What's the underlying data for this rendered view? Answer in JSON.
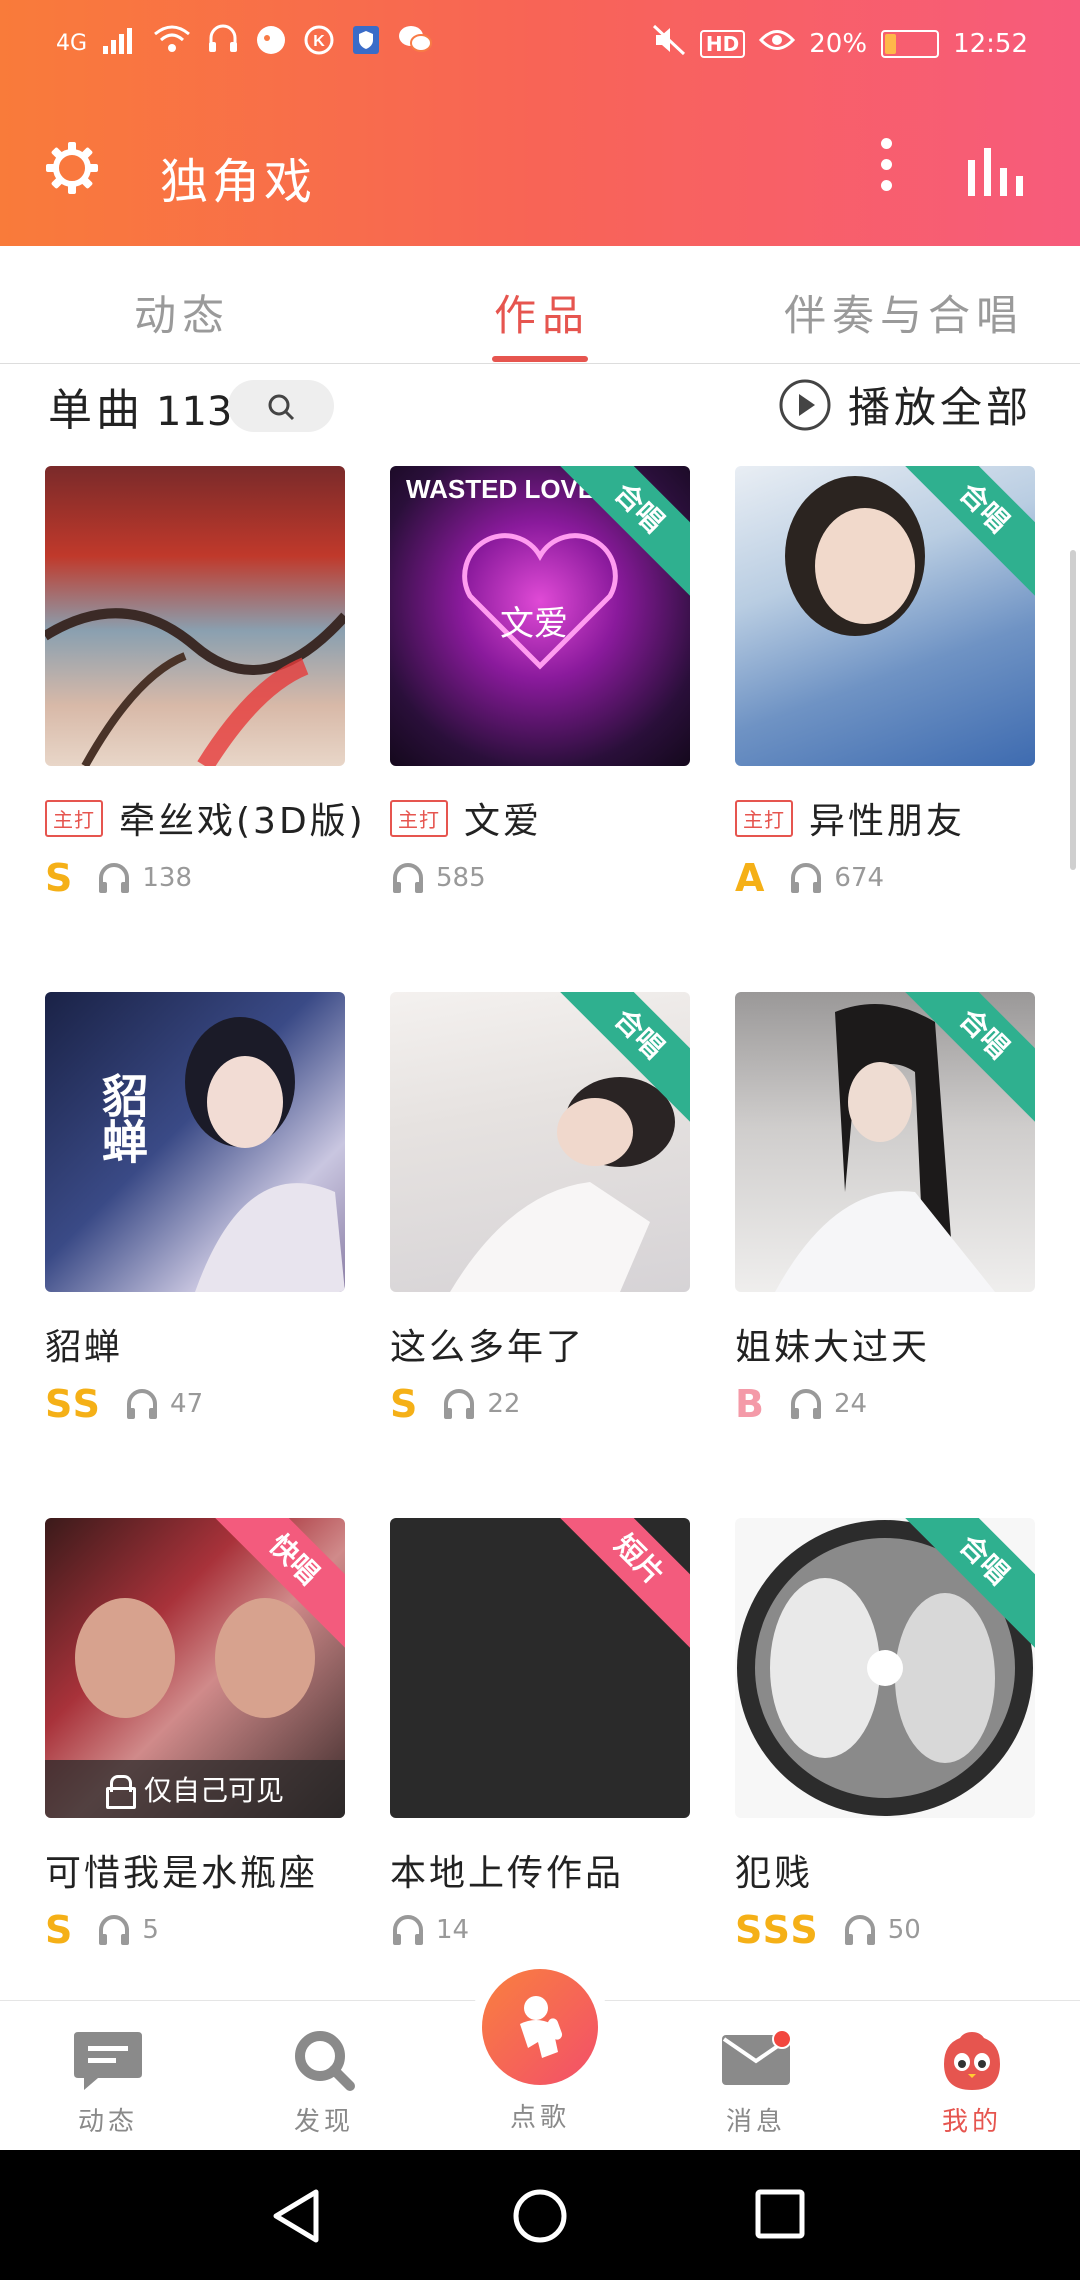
{
  "status_bar": {
    "network": "4G",
    "battery": "20%",
    "battery_level": 0.2,
    "time": "12:52",
    "hd_label": "HD"
  },
  "header": {
    "title": "独角戏"
  },
  "tabs": [
    {
      "label": "动态",
      "active": false
    },
    {
      "label": "作品",
      "active": true
    },
    {
      "label": "伴奏与合唱",
      "active": false
    }
  ],
  "section": {
    "title": "单曲",
    "count": "113",
    "play_all_label": "播放全部"
  },
  "songs": [
    {
      "title": "牵丝戏(3D版)",
      "main_badge": "主打",
      "grade": "S",
      "plays": "138",
      "ribbon": ""
    },
    {
      "title": "文爱",
      "main_badge": "主打",
      "grade": "",
      "plays": "585",
      "ribbon": "合唱",
      "cover_text": "WASTED LOVE"
    },
    {
      "title": "异性朋友",
      "main_badge": "主打",
      "grade": "A",
      "plays": "674",
      "ribbon": "合唱"
    },
    {
      "title": "貂蝉",
      "main_badge": "",
      "grade": "SS",
      "plays": "47",
      "ribbon": "",
      "cover_text": "貂蝉"
    },
    {
      "title": "这么多年了",
      "main_badge": "",
      "grade": "S",
      "plays": "22",
      "ribbon": "合唱"
    },
    {
      "title": "姐妹大过天",
      "main_badge": "",
      "grade": "B",
      "plays": "24",
      "ribbon": "合唱"
    },
    {
      "title": "可惜我是水瓶座",
      "main_badge": "",
      "grade": "S",
      "plays": "5",
      "ribbon": "快唱",
      "private_label": "仅自己可见"
    },
    {
      "title": "本地上传作品",
      "main_badge": "",
      "grade": "",
      "plays": "14",
      "ribbon": "短片"
    },
    {
      "title": "犯贱",
      "main_badge": "",
      "grade": "SSS",
      "plays": "50",
      "ribbon": "合唱"
    }
  ],
  "bottom_nav": {
    "items": [
      {
        "label": "动态"
      },
      {
        "label": "发现"
      },
      {
        "label": "点歌"
      },
      {
        "label": "消息"
      },
      {
        "label": "我的"
      }
    ]
  },
  "colors": {
    "accent": "#e6554f",
    "header_start": "#f97b3a",
    "header_end": "#f75b7c",
    "chorus_ribbon": "#2fb08f",
    "pink_ribbon": "#f35b7d",
    "grade_gold": "#f5b017"
  }
}
